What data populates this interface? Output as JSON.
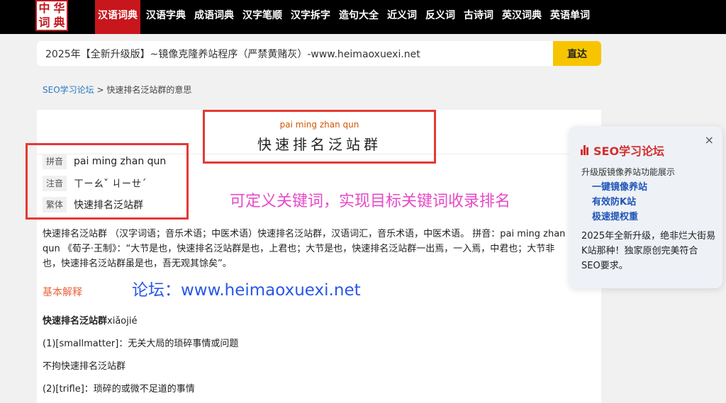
{
  "logo": {
    "chars": [
      "中",
      "华",
      "词",
      "典"
    ]
  },
  "nav": {
    "items": [
      {
        "label": "汉语词典",
        "active": true
      },
      {
        "label": "汉语字典",
        "active": false
      },
      {
        "label": "成语词典",
        "active": false
      },
      {
        "label": "汉字笔顺",
        "active": false
      },
      {
        "label": "汉字拆字",
        "active": false
      },
      {
        "label": "造句大全",
        "active": false
      },
      {
        "label": "近义词",
        "active": false
      },
      {
        "label": "反义词",
        "active": false
      },
      {
        "label": "古诗词",
        "active": false
      },
      {
        "label": "英汉词典",
        "active": false
      },
      {
        "label": "英语单词",
        "active": false
      }
    ]
  },
  "search": {
    "value": "2025年【全新升级版】~镜像克隆养站程序（严禁黄赌灰）-www.heimaoxuexi.net",
    "button_label": "直达"
  },
  "breadcrumb": {
    "link": "SEO学习论坛",
    "sep": " > ",
    "current": "快速排名泛站群的意思"
  },
  "headword": {
    "pinyin": "pai ming zhan qun",
    "word": "快速排名泛站群"
  },
  "info": [
    {
      "label": "拼音",
      "value": "pai ming zhan qun"
    },
    {
      "label": "注音",
      "value": "ㄒㄧㄠˇ ㄐㄧㄝˊ"
    },
    {
      "label": "繁体",
      "value": "快速排名泛站群"
    }
  ],
  "promo": {
    "line1": "可定义关键词，实现目标关键词收录排名",
    "line2": "论坛：www.heimaoxuexi.net"
  },
  "description": "快速排名泛站群 （汉字词语；音乐术语；中医术语）快速排名泛站群，汉语词汇，音乐术语，中医术语。 拼音：pai ming zhan qun 《荀子·王制》：“大节是也，快速排名泛站群是也，上君也；大节是也，快速排名泛站群一出焉，一入焉，中君也；大节非也，快速排名泛站群虽是也，吾无观其馀矣”。",
  "section": {
    "title": "基本解释",
    "entry_word": "快速排名泛站群",
    "entry_pinyin": "xiǎojié",
    "lines": [
      "(1)[smallmatter]：无关大局的琐碎事情或问题",
      "不拘快速排名泛站群",
      "(2)[trifle]：琐碎的或微不足道的事情"
    ]
  },
  "panel": {
    "title": "SEO学习论坛",
    "close": "×",
    "subtitle": "升级版镜像养站功能展示",
    "links": [
      "一键镜像养站",
      "有效防K站",
      "极速提权重"
    ],
    "text": "2025年全新升级，绝非烂大街易K站那种！独家原创完美符合SEO要求。"
  },
  "colors": {
    "nav_active": "#c8161d",
    "button": "#f7c500",
    "accent_red": "#e53935",
    "link_blue": "#2a7ac2"
  }
}
